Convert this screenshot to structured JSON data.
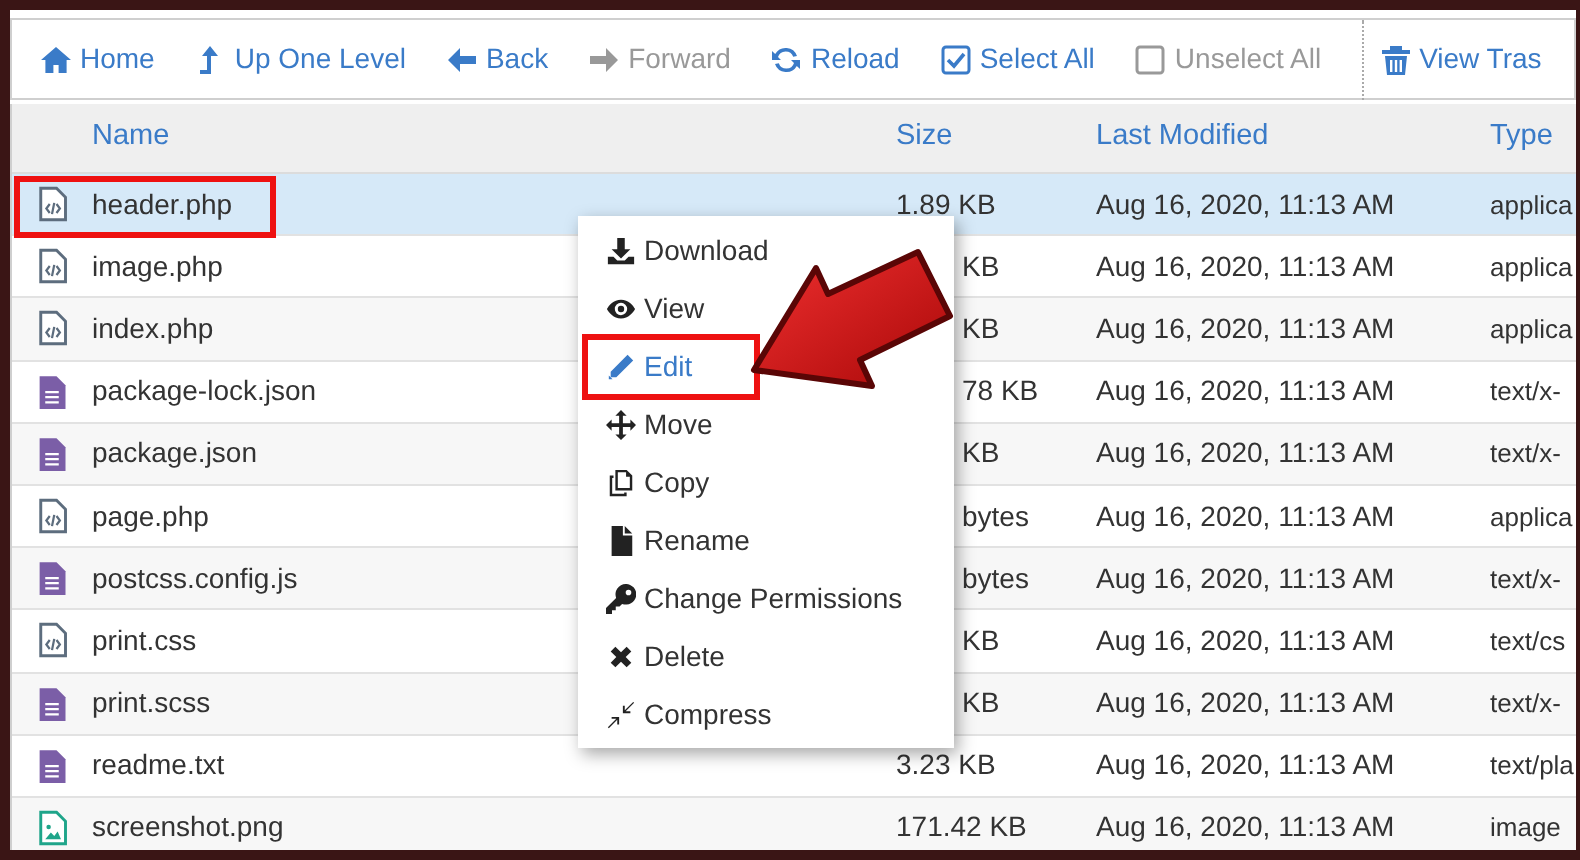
{
  "toolbar": [
    {
      "kind": "home",
      "label": "Home",
      "disabled": false
    },
    {
      "kind": "up",
      "label": "Up One Level",
      "disabled": false
    },
    {
      "kind": "back",
      "label": "Back",
      "disabled": false
    },
    {
      "kind": "forward",
      "label": "Forward",
      "disabled": true
    },
    {
      "kind": "reload",
      "label": "Reload",
      "disabled": false
    },
    {
      "kind": "select",
      "label": "Select All",
      "disabled": false
    },
    {
      "kind": "unselect",
      "label": "Unselect All",
      "disabled": true
    },
    {
      "kind": "trash",
      "label": "View Tras",
      "disabled": false
    }
  ],
  "table": {
    "columns": [
      "Name",
      "Size",
      "Last Modified",
      "Type"
    ],
    "rows": [
      {
        "kind": "code",
        "name": "header.php",
        "size": "1.89 KB",
        "modified": "Aug 16, 2020, 11:13 AM",
        "type": "applica",
        "selected": true,
        "highlighted": true
      },
      {
        "kind": "code",
        "name": "image.php",
        "size": "KB",
        "partly_hidden": true,
        "modified": "Aug 16, 2020, 11:13 AM",
        "type": "applica",
        "selected": false,
        "highlighted": false
      },
      {
        "kind": "code",
        "name": "index.php",
        "size": "KB",
        "partly_hidden": true,
        "modified": "Aug 16, 2020, 11:13 AM",
        "type": "applica",
        "selected": false,
        "highlighted": false
      },
      {
        "kind": "text",
        "name": "package-lock.json",
        "size": "78 KB",
        "partly_hidden": true,
        "modified": "Aug 16, 2020, 11:13 AM",
        "type": "text/x-",
        "selected": false,
        "highlighted": false
      },
      {
        "kind": "text",
        "name": "package.json",
        "size": "KB",
        "partly_hidden": true,
        "modified": "Aug 16, 2020, 11:13 AM",
        "type": "text/x-",
        "selected": false,
        "highlighted": false
      },
      {
        "kind": "code",
        "name": "page.php",
        "size": "bytes",
        "partly_hidden": true,
        "modified": "Aug 16, 2020, 11:13 AM",
        "type": "applica",
        "selected": false,
        "highlighted": false
      },
      {
        "kind": "text",
        "name": "postcss.config.js",
        "size": "bytes",
        "partly_hidden": true,
        "modified": "Aug 16, 2020, 11:13 AM",
        "type": "text/x-",
        "selected": false,
        "highlighted": false
      },
      {
        "kind": "code",
        "name": "print.css",
        "size": "KB",
        "partly_hidden": true,
        "modified": "Aug 16, 2020, 11:13 AM",
        "type": "text/cs",
        "selected": false,
        "highlighted": false
      },
      {
        "kind": "text",
        "name": "print.scss",
        "size": "KB",
        "partly_hidden": true,
        "modified": "Aug 16, 2020, 11:13 AM",
        "type": "text/x-",
        "selected": false,
        "highlighted": false
      },
      {
        "kind": "text",
        "name": "readme.txt",
        "size": "3.23 KB",
        "modified": "Aug 16, 2020, 11:13 AM",
        "type": "text/pla",
        "selected": false,
        "highlighted": false
      },
      {
        "kind": "image",
        "name": "screenshot.png",
        "size": "171.42 KB",
        "modified": "Aug 16, 2020, 11:13 AM",
        "type": "image",
        "selected": false,
        "highlighted": false
      }
    ]
  },
  "context_menu": [
    {
      "kind": "download",
      "label": "Download",
      "active": false,
      "highlighted": false
    },
    {
      "kind": "view",
      "label": "View",
      "active": false,
      "highlighted": false
    },
    {
      "kind": "edit",
      "label": "Edit",
      "active": true,
      "highlighted": true
    },
    {
      "kind": "move",
      "label": "Move",
      "active": false,
      "highlighted": false
    },
    {
      "kind": "copy",
      "label": "Copy",
      "active": false,
      "highlighted": false
    },
    {
      "kind": "rename",
      "label": "Rename",
      "active": false,
      "highlighted": false
    },
    {
      "kind": "permissions",
      "label": "Change Permissions",
      "active": false,
      "highlighted": false
    },
    {
      "kind": "delete",
      "label": "Delete",
      "active": false,
      "highlighted": false
    },
    {
      "kind": "compress",
      "label": "Compress",
      "active": false,
      "highlighted": false
    }
  ]
}
